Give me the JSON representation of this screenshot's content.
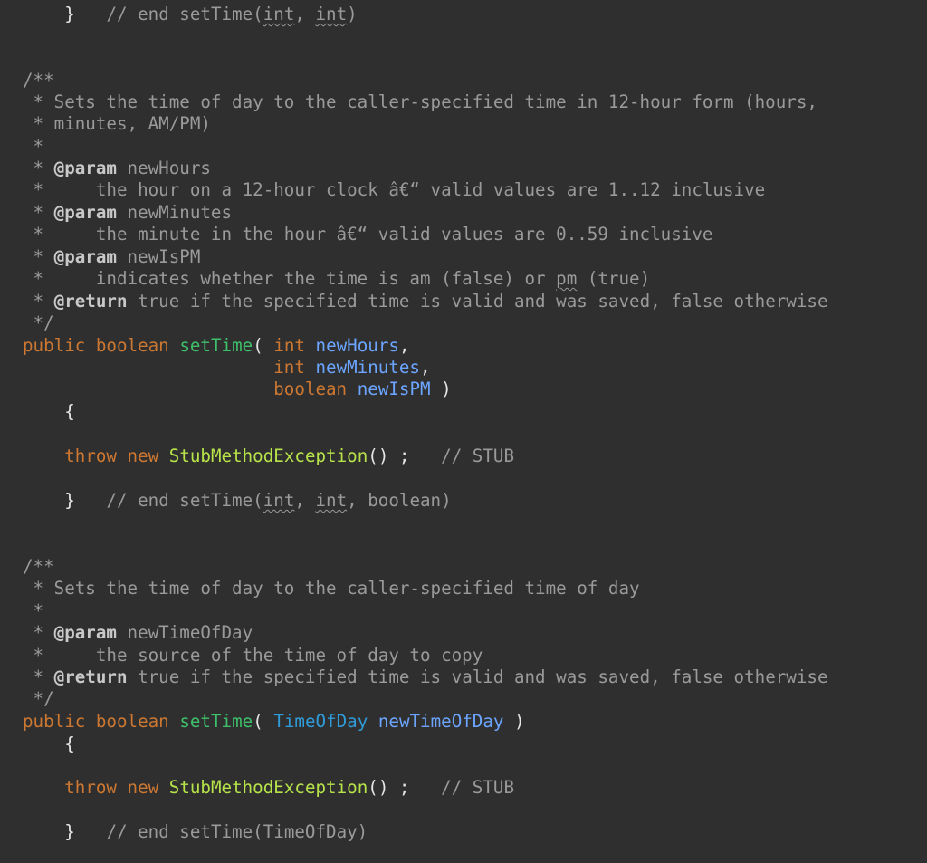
{
  "code": {
    "l_end_settime_ii": {
      "brace": "}",
      "c1": "// end setTime(",
      "w1": "int",
      "c2": ", ",
      "w2": "int",
      "c3": ")"
    },
    "doc1": {
      "open": "/**",
      "summary_a": " * Sets the time of day to the caller-specified time in 12-hour form (hours,",
      "summary_b": " * minutes, AM/PM)",
      "blank": " *",
      "p1_prefix": " * ",
      "p1_tag": "@param",
      "p1_name": " newHours",
      "p1_desc": " *     the hour on a 12-hour clock â€“ valid values are 1..12 inclusive",
      "p2_prefix": " * ",
      "p2_tag": "@param",
      "p2_name": " newMinutes",
      "p2_desc": " *     the minute in the hour â€“ valid values are 0..59 inclusive",
      "p3_prefix": " * ",
      "p3_tag": "@param",
      "p3_name": " newIsPM",
      "p3_desc_a": " *     indicates whether the time is am (false) or ",
      "p3_desc_pm": "pm",
      "p3_desc_b": " (true)",
      "ret_prefix": " * ",
      "ret_tag": "@return",
      "ret_desc": " true if the specified time is valid and was saved, false otherwise",
      "close": " */"
    },
    "sig1": {
      "kw_public": "public",
      "kw_boolean": "boolean",
      "fn": "setTime",
      "paren_open": "(",
      "t1": "int",
      "v1": "newHours",
      "comma1": ",",
      "t2": "int",
      "v2": "newMinutes",
      "comma2": ",",
      "t3": "boolean",
      "v3": "newIsPM",
      "paren_close": ")"
    },
    "body1": {
      "open_brace": "{",
      "kw_throw": "throw",
      "kw_new": "new",
      "cls": "StubMethodException",
      "call": "() ;",
      "comment": "// STUB",
      "close_brace": "}",
      "end_c1": "// end setTime(",
      "end_w1": "int",
      "end_c2": ", ",
      "end_w2": "int",
      "end_c3": ", boolean)"
    },
    "doc2": {
      "open": "/**",
      "summary": " * Sets the time of day to the caller-specified time of day",
      "blank": " *",
      "p1_prefix": " * ",
      "p1_tag": "@param",
      "p1_name": " newTimeOfDay",
      "p1_desc": " *     the source of the time of day to copy",
      "ret_prefix": " * ",
      "ret_tag": "@return",
      "ret_desc": " true if the specified time is valid and was saved, false otherwise",
      "close": " */"
    },
    "sig2": {
      "kw_public": "public",
      "kw_boolean": "boolean",
      "fn": "setTime",
      "paren_open": "(",
      "t1": "TimeOfDay",
      "v1": "newTimeOfDay",
      "paren_close": ")"
    },
    "body2": {
      "open_brace": "{",
      "kw_throw": "throw",
      "kw_new": "new",
      "cls": "StubMethodException",
      "call": "() ;",
      "comment": "// STUB",
      "close_brace": "}",
      "end_comment": "// end setTime(TimeOfDay)"
    }
  },
  "colors": {
    "background": "#2f2f2f",
    "comment": "#9a9a9a",
    "keyword": "#cc7832",
    "method": "#3ec06a",
    "parameter": "#6ba5ff",
    "type": "#2f9bd8",
    "class": "#b7e34a"
  }
}
